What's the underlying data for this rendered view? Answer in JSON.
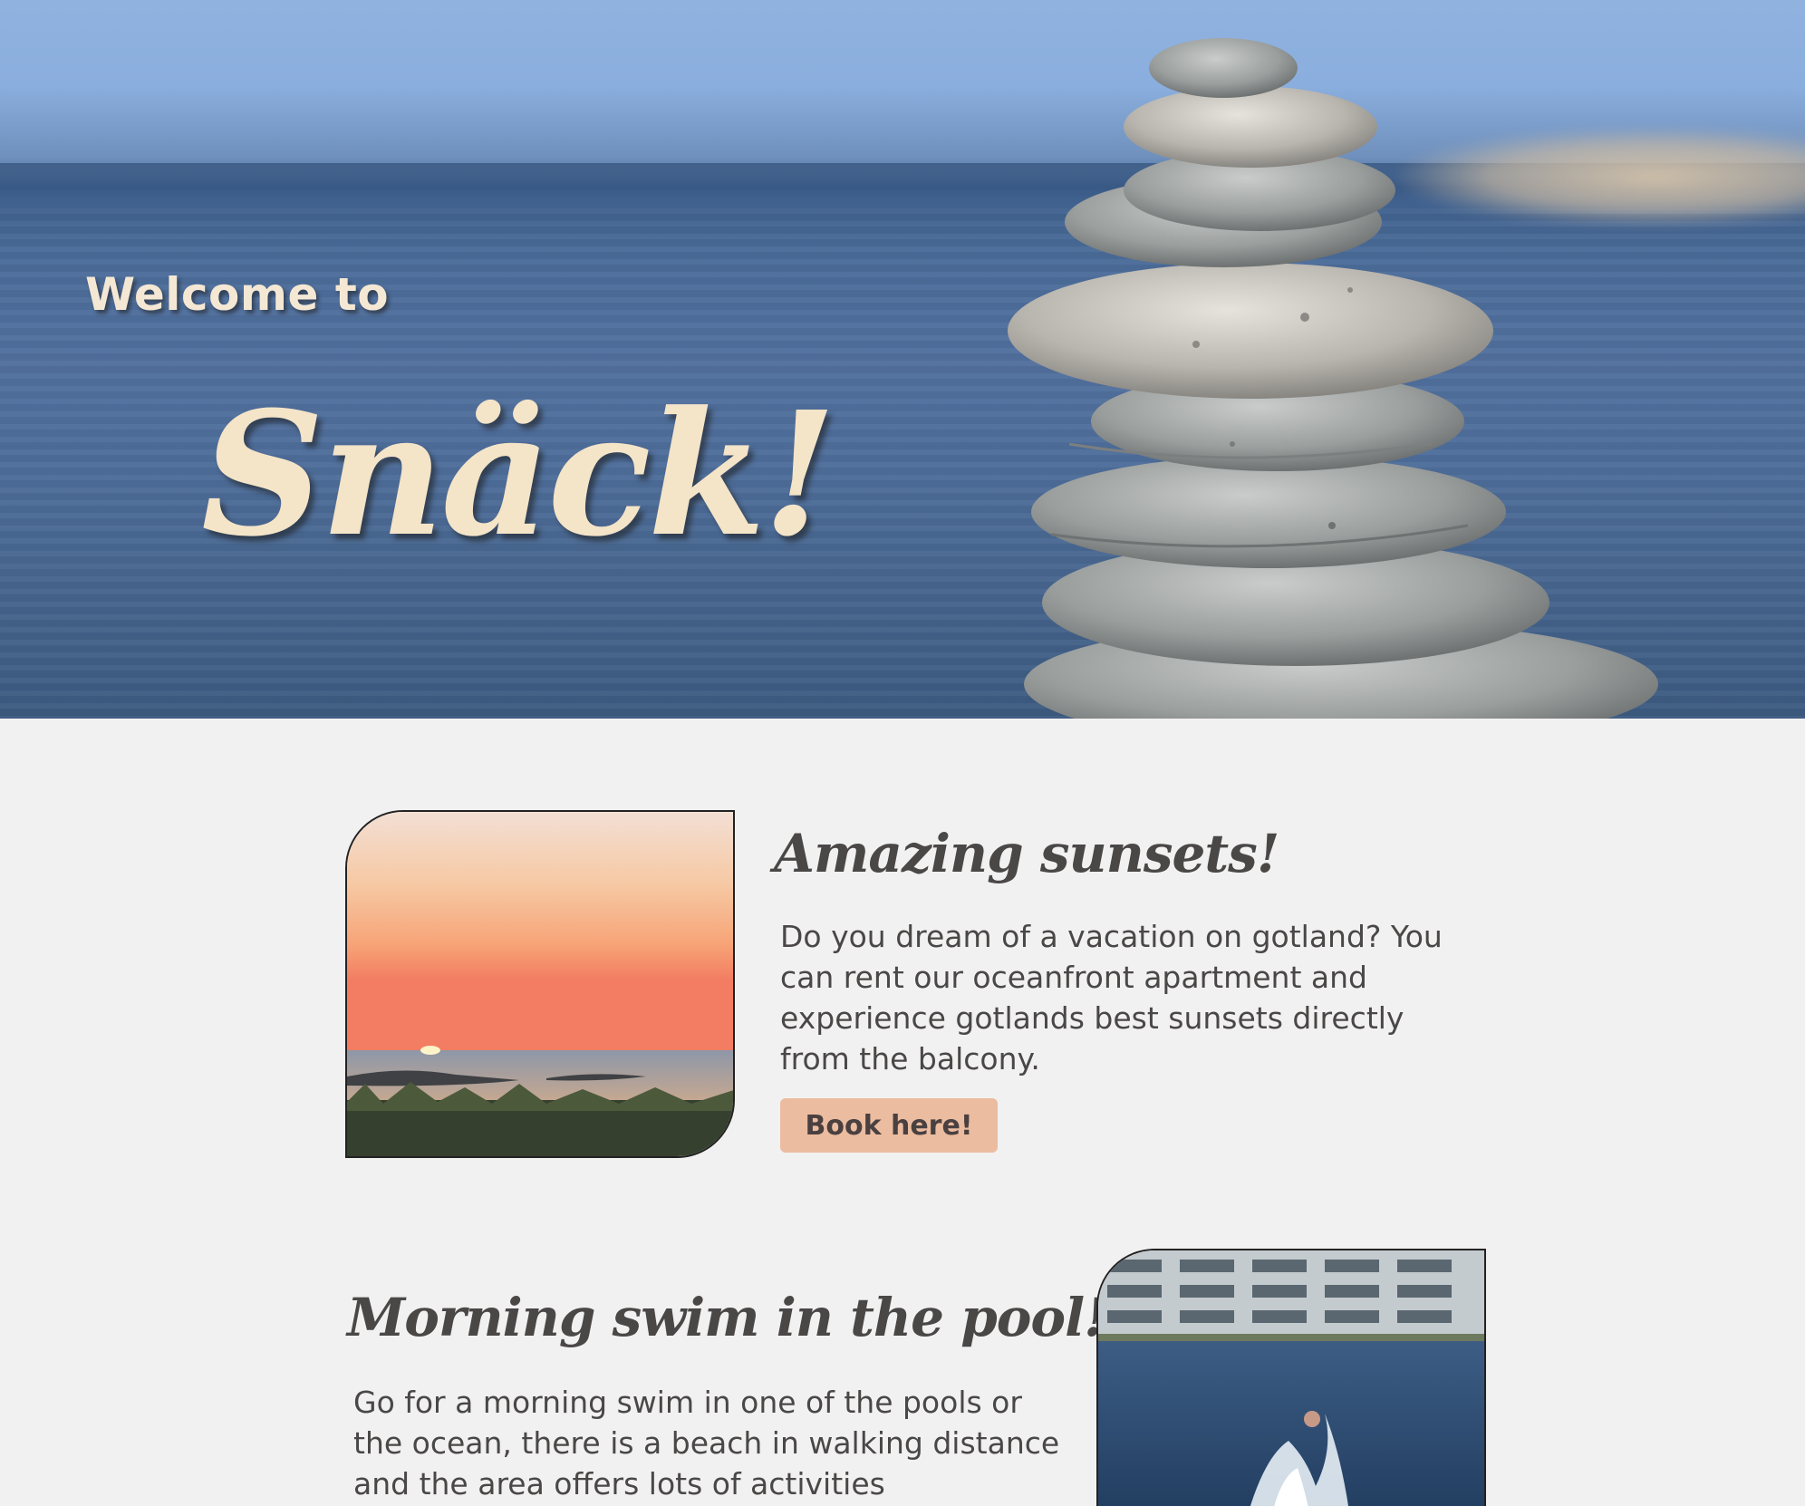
{
  "hero": {
    "welcome": "Welcome to",
    "brand": "Snäck!"
  },
  "features": [
    {
      "title": "Amazing sunsets!",
      "text": "Do you dream of a vacation on gotland? You can rent our oceanfront apartment and experience gotlands best sunsets directly from the balcony.",
      "button_label": "Book here!"
    },
    {
      "title": "Morning swim in the pool!",
      "text": "Go for a morning swim in one of the pools or the ocean, there is a beach in walking distance and the area offers lots of activities"
    }
  ],
  "colors": {
    "background": "#f2f1f1",
    "text": "#4a4747",
    "button": "#ebbca0",
    "hero_text": "#f4e4c8"
  }
}
